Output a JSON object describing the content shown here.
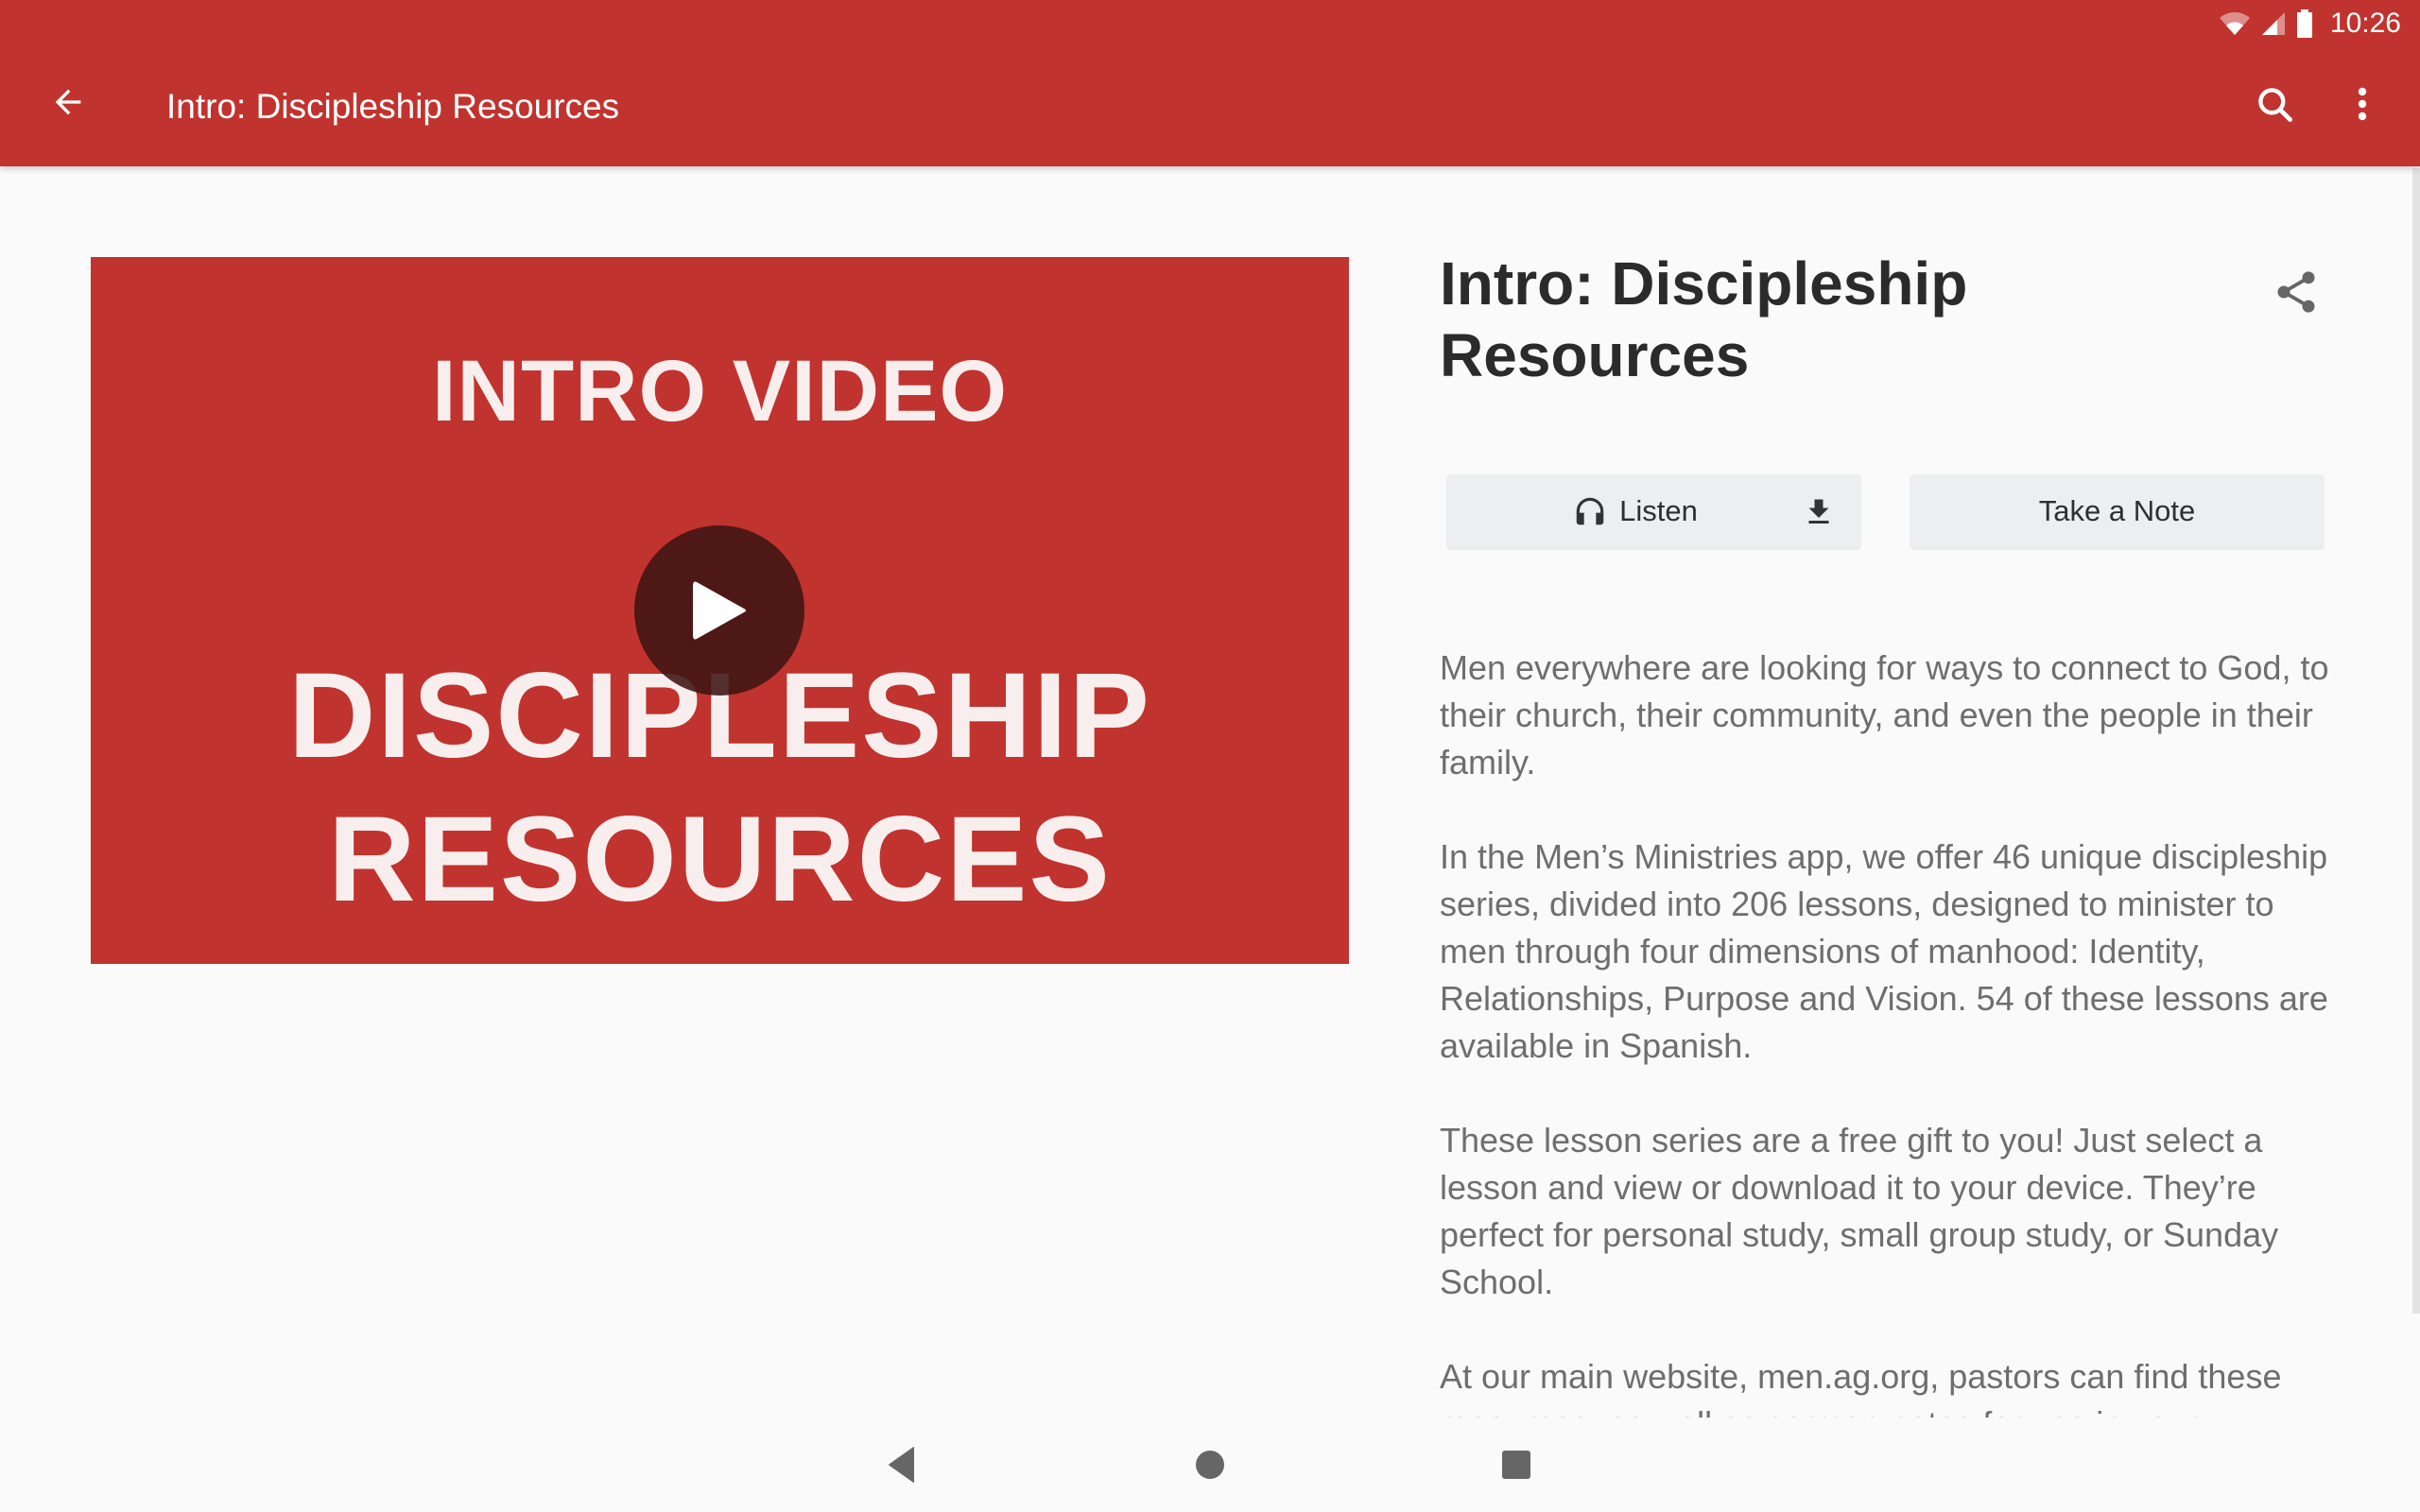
{
  "status_bar": {
    "time": "10:26",
    "icons": [
      "wifi-icon",
      "cell-signal-icon",
      "battery-icon"
    ]
  },
  "app_bar": {
    "title": "Intro: Discipleship Resources",
    "back_icon": "arrow-left-icon",
    "search_icon": "search-icon",
    "more_icon": "more-vert-icon",
    "color": "#c1332e"
  },
  "video": {
    "line1": "INTRO VIDEO",
    "line2": "DISCIPLESHIP",
    "line3": "RESOURCES",
    "play_icon": "play-icon"
  },
  "detail": {
    "title": "Intro: Discipleship Resources",
    "share_icon": "share-icon",
    "listen_label": "Listen",
    "listen_icon": "headphones-icon",
    "download_icon": "download-icon",
    "note_label": "Take a Note"
  },
  "description": {
    "paragraphs": [
      "Men everywhere are looking for ways to connect to God, to their church, their community, and even the people in their family.",
      "In the Men’s Ministries app, we offer 46 unique discipleship series, divided into 206 lessons, designed to minister to men through four dimensions of manhood: Identity, Relationships, Purpose and Vision. 54 of these lessons are available in Spanish.",
      "These lesson series are a free gift to you! Just select a lesson and view or download it to your device. They’re perfect for personal study, small group study, or Sunday School.",
      "At our main website, men.ag.org, pastors can find these resources, as well as sermon notes for use in your"
    ]
  },
  "nav_bar": {
    "back_icon": "nav-back-icon",
    "home_icon": "nav-home-icon",
    "recents_icon": "nav-recents-icon"
  }
}
